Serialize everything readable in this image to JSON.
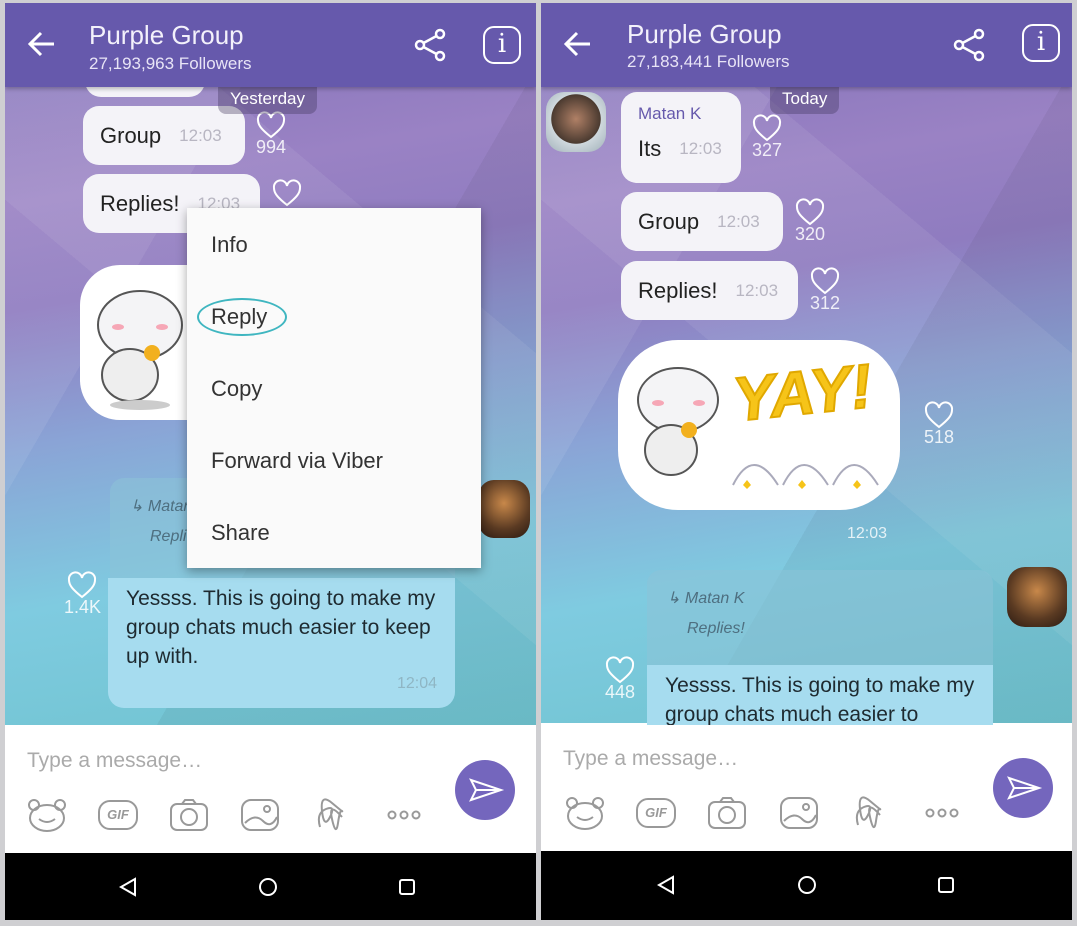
{
  "left": {
    "header": {
      "title": "Purple Group",
      "followers": "27,193,963 Followers"
    },
    "date_chip": "Yesterday",
    "messages": [
      {
        "text": "Group",
        "time": "12:03",
        "likes": "994"
      },
      {
        "text": "Replies!",
        "time": "12:03",
        "likes": ""
      }
    ],
    "context_menu": [
      "Info",
      "Reply",
      "Copy",
      "Forward via Viber",
      "Share"
    ],
    "reply": {
      "quoted_name": "Matan K",
      "quoted_text": "Replies!",
      "text": "Yessss. This is going to make my group chats much easier to keep up with.",
      "time": "12:04",
      "likes": "1.4K"
    },
    "input": {
      "placeholder": "Type a message…"
    }
  },
  "right": {
    "header": {
      "title": "Purple Group",
      "followers": "27,183,441 Followers"
    },
    "date_chip": "Today",
    "messages": [
      {
        "sender": "Matan K",
        "text": "Its",
        "time": "12:03",
        "likes": "327"
      },
      {
        "text": "Group",
        "time": "12:03",
        "likes": "320"
      },
      {
        "text": "Replies!",
        "time": "12:03",
        "likes": "312"
      }
    ],
    "sticker": {
      "text": "YAY!",
      "time": "12:03",
      "likes": "518"
    },
    "reply": {
      "quoted_name": "Matan K",
      "quoted_text": "Replies!",
      "text": "Yessss. This is going to make my group chats much easier to",
      "likes": "448"
    },
    "input": {
      "placeholder": "Type a message…"
    }
  },
  "toolbar_icons": [
    "sticker-bear-icon",
    "gif-icon",
    "camera-icon",
    "gallery-icon",
    "doodle-icon",
    "more-icon"
  ],
  "toolbar_gif_label": "GIF",
  "colors": {
    "header": "#6659ac",
    "send": "#7466bd",
    "reply_highlight": "#3fb6c0"
  }
}
